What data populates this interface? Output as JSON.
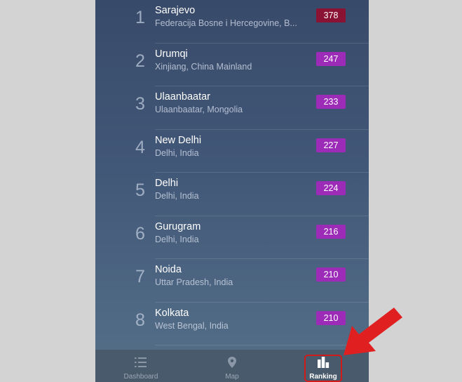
{
  "ranking": [
    {
      "rank": "1",
      "city": "Sarajevo",
      "region": "Federacija Bosne i Hercegovine, B...",
      "aqi": "378",
      "level": "hazardous",
      "color": "#8a1232"
    },
    {
      "rank": "2",
      "city": "Urumqi",
      "region": "Xinjiang, China Mainland",
      "aqi": "247",
      "level": "very-unhealthy",
      "color": "#9c2bb8"
    },
    {
      "rank": "3",
      "city": "Ulaanbaatar",
      "region": "Ulaanbaatar, Mongolia",
      "aqi": "233",
      "level": "very-unhealthy",
      "color": "#9c2bb8"
    },
    {
      "rank": "4",
      "city": "New Delhi",
      "region": "Delhi, India",
      "aqi": "227",
      "level": "very-unhealthy",
      "color": "#9c2bb8"
    },
    {
      "rank": "5",
      "city": "Delhi",
      "region": "Delhi, India",
      "aqi": "224",
      "level": "very-unhealthy",
      "color": "#9c2bb8"
    },
    {
      "rank": "6",
      "city": "Gurugram",
      "region": "Delhi, India",
      "aqi": "216",
      "level": "very-unhealthy",
      "color": "#9c2bb8"
    },
    {
      "rank": "7",
      "city": "Noida",
      "region": "Uttar Pradesh, India",
      "aqi": "210",
      "level": "very-unhealthy",
      "color": "#9c2bb8"
    },
    {
      "rank": "8",
      "city": "Kolkata",
      "region": "West Bengal, India",
      "aqi": "210",
      "level": "very-unhealthy",
      "color": "#9c2bb8"
    }
  ],
  "tabbar": {
    "tabs": [
      {
        "label": "Dashboard",
        "icon": "list-icon",
        "active": false
      },
      {
        "label": "Map",
        "icon": "map-pin-icon",
        "active": false
      },
      {
        "label": "Ranking",
        "icon": "bar-chart-icon",
        "active": true
      }
    ]
  },
  "annotation": {
    "arrow_color": "#e02020",
    "highlight_color": "#d11a1a"
  }
}
